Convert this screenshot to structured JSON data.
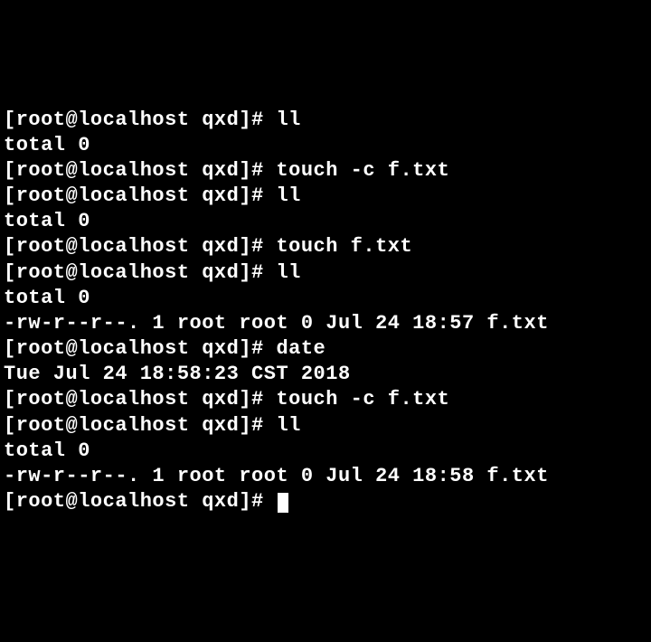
{
  "terminal": {
    "lines": [
      {
        "prompt": "[root@localhost qxd]# ",
        "cmd": "ll"
      },
      {
        "out": "total 0"
      },
      {
        "prompt": "[root@localhost qxd]# ",
        "cmd": "touch -c f.txt"
      },
      {
        "prompt": "[root@localhost qxd]# ",
        "cmd": "ll"
      },
      {
        "out": "total 0"
      },
      {
        "prompt": "[root@localhost qxd]# ",
        "cmd": "touch f.txt"
      },
      {
        "prompt": "[root@localhost qxd]# ",
        "cmd": "ll"
      },
      {
        "out": "total 0"
      },
      {
        "out": "-rw-r--r--. 1 root root 0 Jul 24 18:57 f.txt"
      },
      {
        "prompt": "[root@localhost qxd]# ",
        "cmd": "date"
      },
      {
        "out": "Tue Jul 24 18:58:23 CST 2018"
      },
      {
        "prompt": "[root@localhost qxd]# ",
        "cmd": "touch -c f.txt"
      },
      {
        "prompt": "[root@localhost qxd]# ",
        "cmd": "ll"
      },
      {
        "out": "total 0"
      },
      {
        "out": "-rw-r--r--. 1 root root 0 Jul 24 18:58 f.txt"
      },
      {
        "prompt": "[root@localhost qxd]# ",
        "cmd": "",
        "cursor": true
      }
    ]
  }
}
